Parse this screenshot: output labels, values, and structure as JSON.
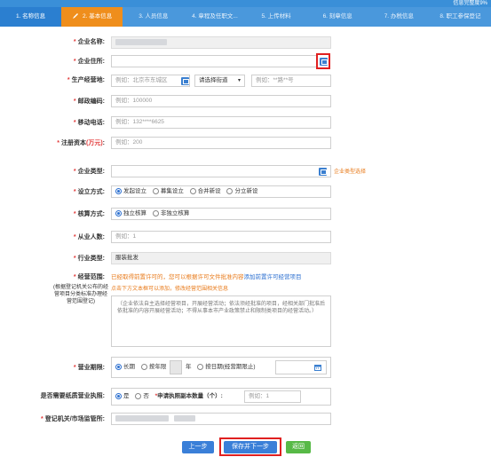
{
  "progress": {
    "text": "信息完整度9%"
  },
  "steps": [
    {
      "label": "1. 名称信息"
    },
    {
      "label": "2. 基本信息"
    },
    {
      "label": "3. 人员信息"
    },
    {
      "label": "4. 章程及任职文..."
    },
    {
      "label": "5. 上传材料"
    },
    {
      "label": "6. 刻章信息"
    },
    {
      "label": "7. 办税信息"
    },
    {
      "label": "8. 职工参保登记"
    }
  ],
  "form": {
    "company_name_label": "企业名称:",
    "address_label": "企业住所:",
    "business_place_label": "生产经营地:",
    "business_place_placeholder": "例如：北京市东城区",
    "street_select": "请选择街道",
    "house_placeholder": "例如：**路**号",
    "postcode_label": "邮政编码:",
    "postcode_placeholder": "例如：100000",
    "mobile_label": "移动电话:",
    "mobile_placeholder": "例如：132****6625",
    "capital_label_pre": "注册资本",
    "capital_label_unit": "(万元)",
    "capital_label_post": ":",
    "capital_placeholder": "例如：200",
    "company_type_label": "企业类型:",
    "company_type_link": "企业类型选择",
    "setup_label": "设立方式:",
    "setup_options": [
      "发起设立",
      "募集设立",
      "合并新设",
      "分立新设"
    ],
    "accounting_label": "核算方式:",
    "accounting_options": [
      "独立核算",
      "非独立核算"
    ],
    "employees_label": "从业人数:",
    "employees_placeholder": "例如：1",
    "industry_label": "行业类型:",
    "industry_value": "服装批发",
    "scope_label": "经营范围:",
    "scope_notice_orange": "已经取得前置许可的，您可以根据许可文件批准内容",
    "scope_notice_link": "添加前置许可经营项目",
    "scope_side_note": "(根据登记机关公布的经营项目分类标准办理经营范围登记)",
    "scope_hint": "点击下方文本框可以添加，修改经营范围相关信息",
    "scope_textarea": "（企业依法自主选择经营项目，开展经营活动；依法须经批准的项目，经相关部门批准后依批准的内容开展经营活动；不得从事本市产业政策禁止和限制类项目的经营活动。）",
    "term_label": "营业期限:",
    "term_options": [
      "长期",
      "按年限",
      "按日期(经营期限止)"
    ],
    "term_year_unit": "年",
    "license_label": "是否需要纸质营业执照:",
    "license_options": [
      "是",
      "否"
    ],
    "copies_label": "申请执照副本数量（个）:",
    "copies_placeholder": "例如：1",
    "authority_label": "登记机关/市场监管所:"
  },
  "buttons": {
    "prev": "上一步",
    "save_next": "保存并下一步",
    "back": "返回"
  }
}
